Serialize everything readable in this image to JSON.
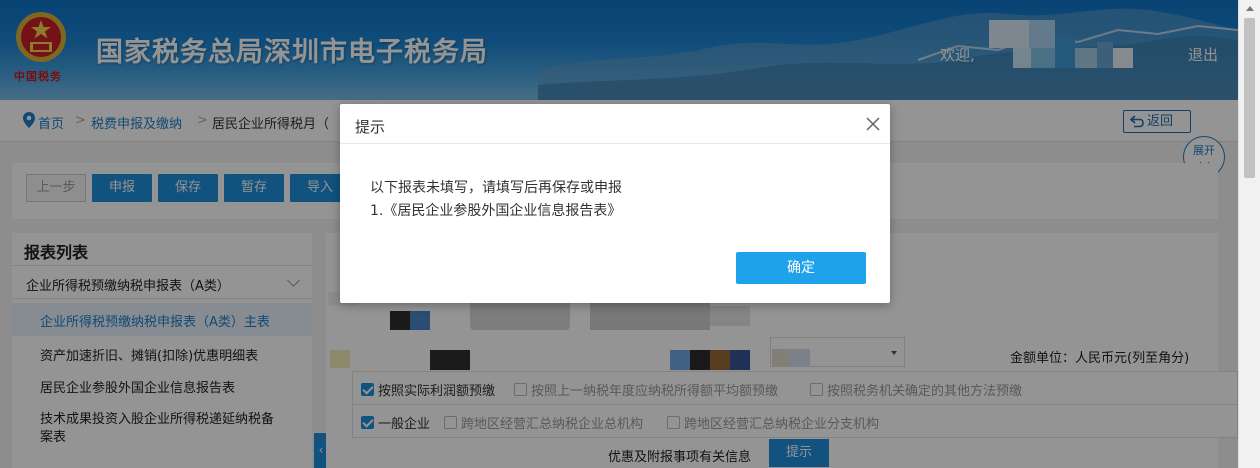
{
  "header": {
    "emblem_caption": "中国税务",
    "site_title": "国家税务总局深圳市电子税务局",
    "welcome": "欢迎,",
    "logout": "退出"
  },
  "breadcrumb": {
    "home": "首页",
    "tax_filing": "税费申报及缴纳",
    "current": "居民企业所得税月（"
  },
  "actions": {
    "back": "返回",
    "expand": "展开"
  },
  "toolbar": {
    "prev": "上一步",
    "submit": "申报",
    "save": "保存",
    "draft": "暂存",
    "import": "导入"
  },
  "sidebar": {
    "title": "报表列表",
    "group": "企业所得税预缴纳税申报表（A类）",
    "items": [
      {
        "label": "企业所得税预缴纳税申报表（A类）主表"
      },
      {
        "label": "资产加速折旧、摊销(扣除)优惠明细表"
      },
      {
        "label": "居民企业参股外国企业信息报告表"
      },
      {
        "label": "技术成果投资入股企业所得税递延纳税备"
      },
      {
        "label": "案表"
      }
    ]
  },
  "main": {
    "unit": "金额单位：人民币元(列至角分)",
    "options_row1": [
      {
        "label": "按照实际利润额预缴",
        "checked": true
      },
      {
        "label": "按照上一纳税年度应纳税所得额平均额预缴",
        "checked": false
      },
      {
        "label": "按照税务机关确定的其他方法预缴",
        "checked": false
      }
    ],
    "options_row2": [
      {
        "label": "一般企业",
        "checked": true
      },
      {
        "label": "跨地区经营汇总纳税企业总机构",
        "checked": false
      },
      {
        "label": "跨地区经营汇总纳税企业分支机构",
        "checked": false
      }
    ],
    "info_label": "优惠及附报事项有关信息",
    "hint_button": "提示"
  },
  "dialog": {
    "title": "提示",
    "line1": "以下报表未填写，请填写后再保存或申报",
    "line2": "1.《居民企业参股外国企业信息报告表》",
    "ok": "确定"
  },
  "colors": {
    "primary": "#1e8fd9",
    "dialog_ok": "#1ea2ea",
    "header_blue": "#0d73c7",
    "emblem_red": "#d01919"
  },
  "icons": [
    "location-pin-icon",
    "back-arrow-icon",
    "close-icon",
    "chevron-down-icon",
    "checkbox-icon",
    "emblem-icon"
  ]
}
